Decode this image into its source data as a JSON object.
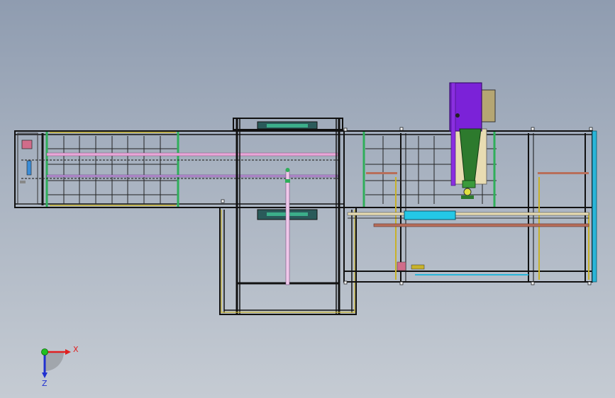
{
  "triad": {
    "x_label": "X",
    "z_label": "Z",
    "x_color": "#e02020",
    "y_color": "#20c020",
    "z_color": "#2030d0"
  },
  "colors": {
    "frame": "#111111",
    "frame_green": "#2fae5a",
    "frame_yellow": "#c8b22a",
    "pink_rail": "#e9a7d8",
    "cyan_cylinder": "#24c8e6",
    "purple_box": "#7b22d8",
    "green_cone": "#2d7a2d",
    "tan_plate": "#e8dcb2",
    "brown_rail": "#b86e5a",
    "cyan_edge": "#2ab5d8"
  }
}
